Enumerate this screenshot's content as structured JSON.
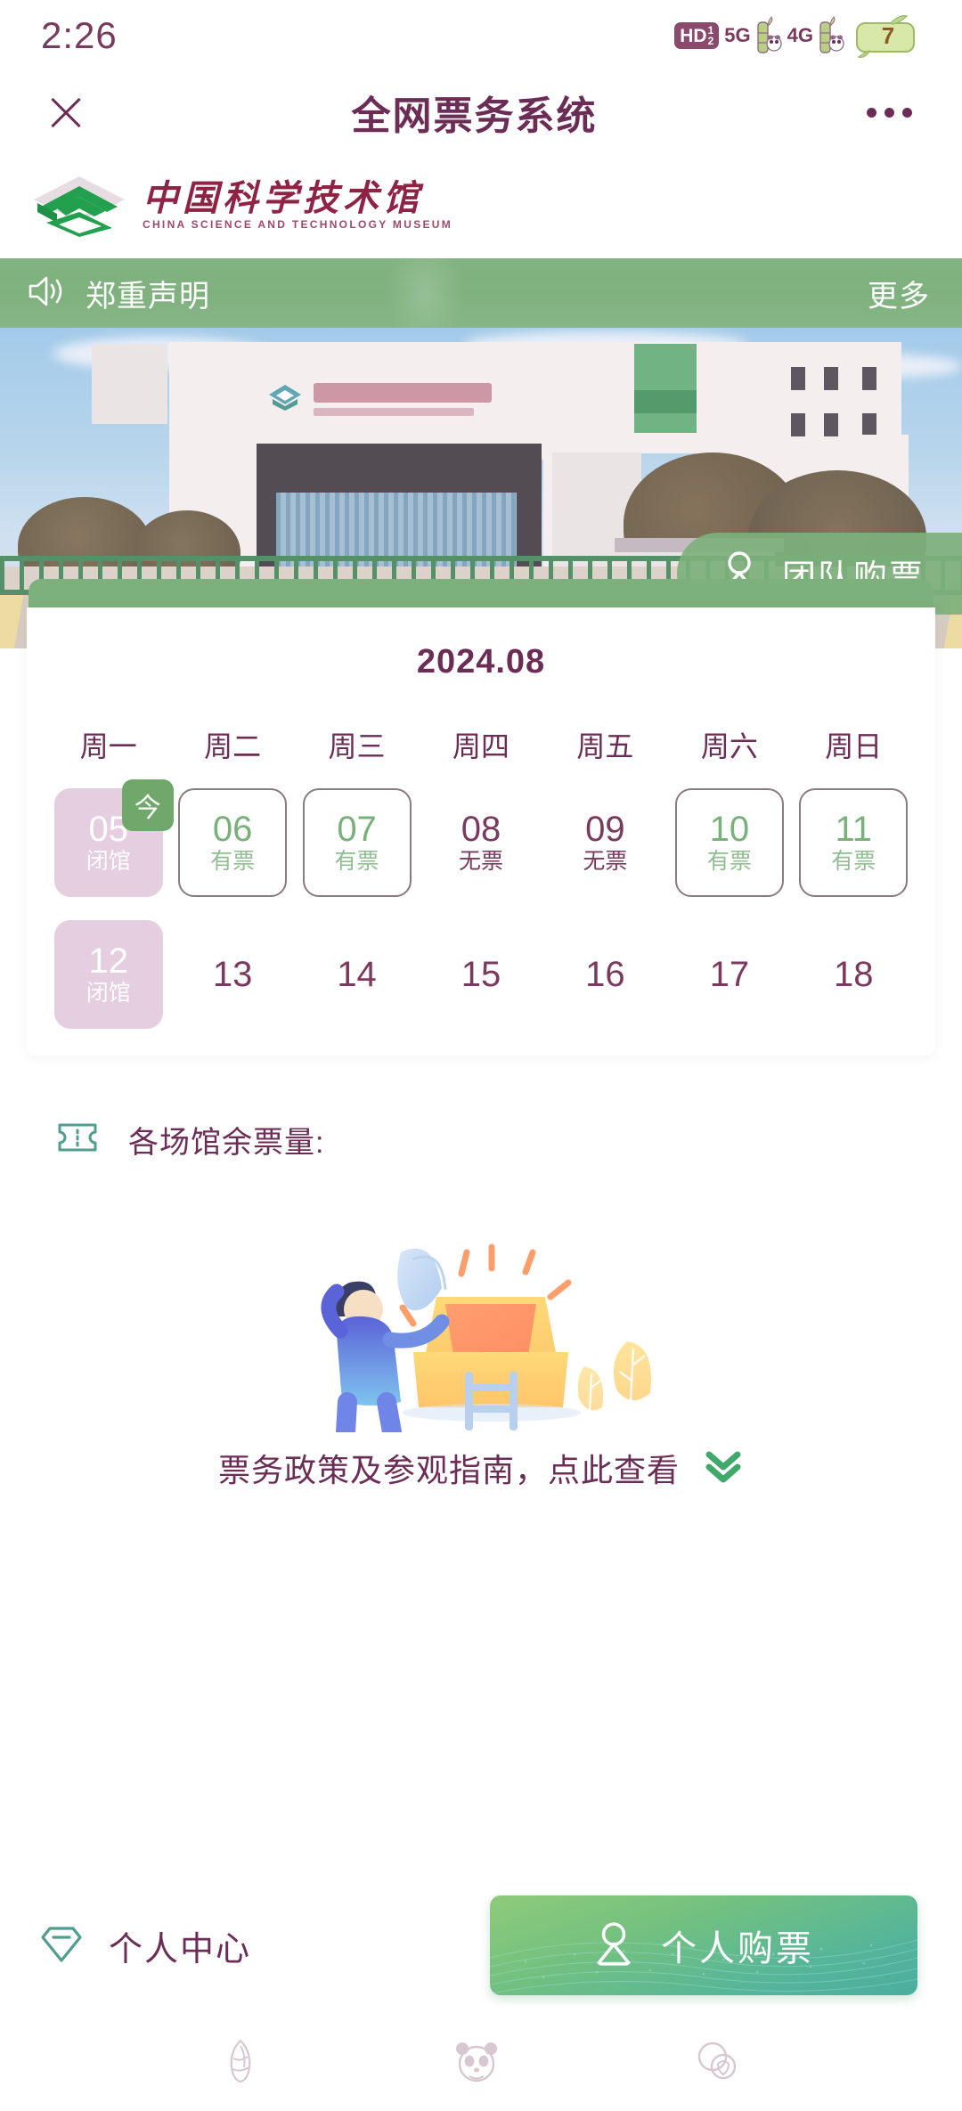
{
  "status_bar": {
    "time": "2:26",
    "hd_label": "HD",
    "hd_sub": "1/2",
    "network_labels": [
      "5G",
      "4G"
    ],
    "battery_level": "7",
    "icons": [
      "hd-icon",
      "signal-bamboo-icon",
      "battery-bamboo-icon"
    ]
  },
  "nav": {
    "close_icon": "close-icon",
    "title": "全网票务系统",
    "more_icon": "more-options-icon"
  },
  "brand": {
    "name_cn": "中国科学技术馆",
    "name_en": "CHINA SCIENCE AND TECHNOLOGY MUSEUM",
    "logo_icon": "cstm-logo-icon"
  },
  "announcement": {
    "speaker_icon": "speaker-icon",
    "text": "郑重声明",
    "more_label": "更多"
  },
  "hero": {
    "group_ticket": {
      "icon": "person-icon",
      "label": "团队购票"
    }
  },
  "calendar": {
    "month": "2024.08",
    "weekdays": [
      "周一",
      "周二",
      "周三",
      "周四",
      "周五",
      "周六",
      "周日"
    ],
    "today_badge": "今",
    "status_labels": {
      "closed": "闭馆",
      "available": "有票",
      "sold_out": "无票"
    },
    "days": [
      {
        "num": "05",
        "status": "闭馆",
        "state": "closed",
        "today": true
      },
      {
        "num": "06",
        "status": "有票",
        "state": "avail",
        "today": false
      },
      {
        "num": "07",
        "status": "有票",
        "state": "avail",
        "today": false
      },
      {
        "num": "08",
        "status": "无票",
        "state": "none",
        "today": false
      },
      {
        "num": "09",
        "status": "无票",
        "state": "none",
        "today": false
      },
      {
        "num": "10",
        "status": "有票",
        "state": "avail",
        "today": false
      },
      {
        "num": "11",
        "status": "有票",
        "state": "avail",
        "today": false
      },
      {
        "num": "12",
        "status": "闭馆",
        "state": "closed",
        "today": false
      },
      {
        "num": "13",
        "status": "",
        "state": "plain",
        "today": false
      },
      {
        "num": "14",
        "status": "",
        "state": "plain",
        "today": false
      },
      {
        "num": "15",
        "status": "",
        "state": "plain",
        "today": false
      },
      {
        "num": "16",
        "status": "",
        "state": "plain",
        "today": false
      },
      {
        "num": "17",
        "status": "",
        "state": "plain",
        "today": false
      },
      {
        "num": "18",
        "status": "",
        "state": "plain",
        "today": false
      }
    ]
  },
  "venue_section": {
    "ticket_icon": "ticket-icon",
    "label": "各场馆余票量:",
    "empty_illustration": "empty-box-illustration"
  },
  "policy": {
    "text": "票务政策及参观指南，点此查看",
    "chevron_icon": "double-chevron-down-icon"
  },
  "bottom_bar": {
    "personal_center": {
      "icon": "gem-icon",
      "label": "个人中心"
    },
    "buy_button": {
      "icon": "person-icon",
      "label": "个人购票"
    }
  },
  "bottom_nav": {
    "items": [
      {
        "icon": "bamboo-shoot-icon"
      },
      {
        "icon": "panda-face-icon"
      },
      {
        "icon": "two-circles-icon"
      }
    ]
  },
  "colors": {
    "brand_purple": "#6b2d55",
    "brand_green": "#7cb07c",
    "accent_green": "#6fa86a",
    "closed_pink": "#e5cee0",
    "logo_red": "#8f2346",
    "teal": "#4f9e8e"
  }
}
